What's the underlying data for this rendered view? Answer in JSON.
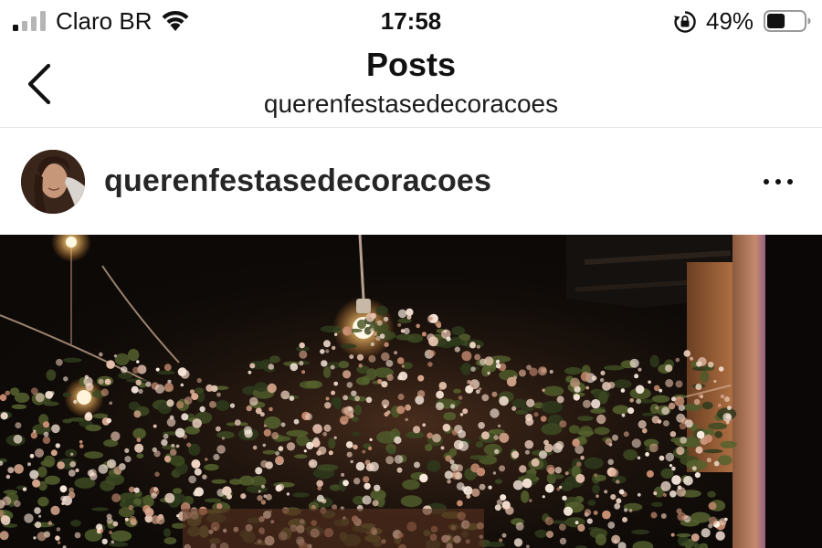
{
  "status_bar": {
    "carrier": "Claro BR",
    "time": "17:58",
    "battery_percent": "49%",
    "battery_level": 0.49,
    "icons": [
      "signal-icon",
      "wifi-icon",
      "orientation-lock-icon",
      "battery-icon"
    ]
  },
  "nav": {
    "title": "Posts",
    "subtitle": "querenfestasedecoracoes",
    "back_icon": "chevron-left-icon"
  },
  "post": {
    "username": "querenfestasedecoracoes",
    "more_icon": "more-horizontal-icon",
    "avatar": "avatar"
  },
  "colors": {
    "text": "#262626",
    "divider": "#e6e6e6",
    "background": "#ffffff"
  }
}
